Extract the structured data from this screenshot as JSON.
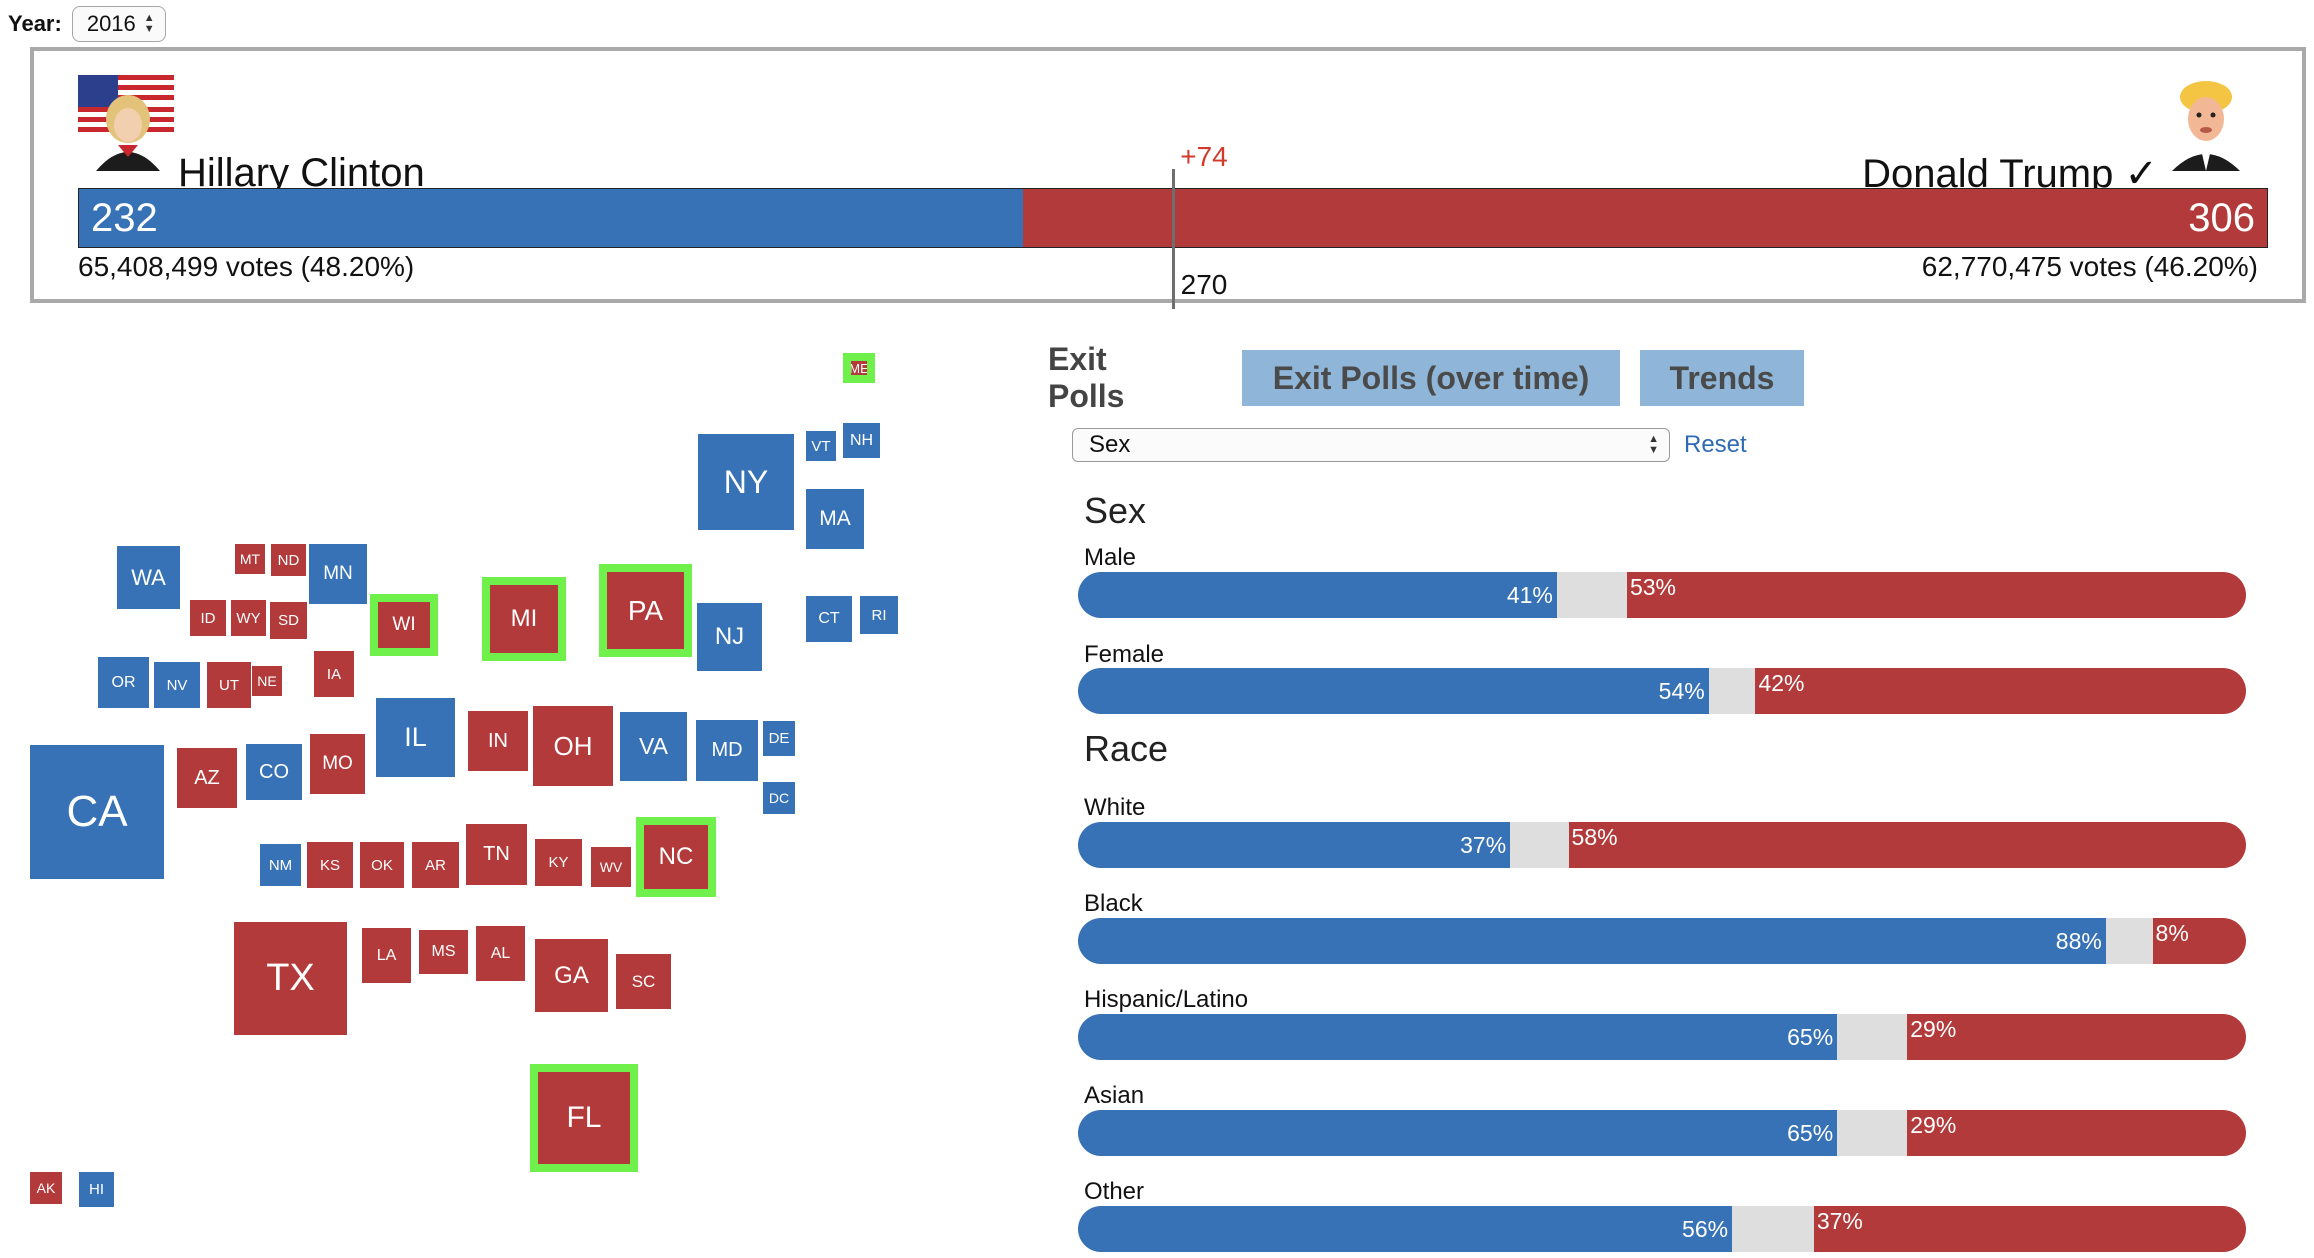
{
  "year": {
    "label": "Year:",
    "value": "2016"
  },
  "summary": {
    "left": {
      "name": "Hillary Clinton",
      "ev": "232",
      "votes": "65,408,499 votes (48.20%)",
      "ev_value": 232,
      "color": "#3672b5"
    },
    "right": {
      "name": "Donald Trump ✓",
      "ev": "306",
      "votes": "62,770,475 votes (46.20%)",
      "ev_value": 306,
      "color": "#b23a3a"
    },
    "margin": "+74",
    "threshold": "270"
  },
  "colors": {
    "dem": "#3672b5",
    "rep": "#b23a3a",
    "highlight": "#6ff04a",
    "undecided": "#dedede"
  },
  "states": [
    {
      "code": "ME",
      "party": "rep",
      "hl": true
    },
    {
      "code": "VT",
      "party": "dem"
    },
    {
      "code": "NH",
      "party": "dem"
    },
    {
      "code": "NY",
      "party": "dem"
    },
    {
      "code": "MA",
      "party": "dem"
    },
    {
      "code": "WA",
      "party": "dem"
    },
    {
      "code": "MT",
      "party": "rep"
    },
    {
      "code": "ND",
      "party": "rep"
    },
    {
      "code": "MN",
      "party": "dem"
    },
    {
      "code": "ID",
      "party": "rep"
    },
    {
      "code": "WY",
      "party": "rep"
    },
    {
      "code": "SD",
      "party": "rep"
    },
    {
      "code": "WI",
      "party": "rep",
      "hl": true
    },
    {
      "code": "MI",
      "party": "rep",
      "hl": true
    },
    {
      "code": "PA",
      "party": "rep",
      "hl": true
    },
    {
      "code": "NJ",
      "party": "dem"
    },
    {
      "code": "CT",
      "party": "dem"
    },
    {
      "code": "RI",
      "party": "dem"
    },
    {
      "code": "OR",
      "party": "dem"
    },
    {
      "code": "NV",
      "party": "dem"
    },
    {
      "code": "UT",
      "party": "rep"
    },
    {
      "code": "NE",
      "party": "rep"
    },
    {
      "code": "IA",
      "party": "rep"
    },
    {
      "code": "IL",
      "party": "dem"
    },
    {
      "code": "IN",
      "party": "rep"
    },
    {
      "code": "OH",
      "party": "rep"
    },
    {
      "code": "VA",
      "party": "dem"
    },
    {
      "code": "MD",
      "party": "dem"
    },
    {
      "code": "DE",
      "party": "dem"
    },
    {
      "code": "DC",
      "party": "dem"
    },
    {
      "code": "CA",
      "party": "dem"
    },
    {
      "code": "AZ",
      "party": "rep"
    },
    {
      "code": "CO",
      "party": "dem"
    },
    {
      "code": "MO",
      "party": "rep"
    },
    {
      "code": "NM",
      "party": "dem"
    },
    {
      "code": "KS",
      "party": "rep"
    },
    {
      "code": "OK",
      "party": "rep"
    },
    {
      "code": "AR",
      "party": "rep"
    },
    {
      "code": "TN",
      "party": "rep"
    },
    {
      "code": "KY",
      "party": "rep"
    },
    {
      "code": "WV",
      "party": "rep"
    },
    {
      "code": "NC",
      "party": "rep",
      "hl": true
    },
    {
      "code": "TX",
      "party": "rep"
    },
    {
      "code": "LA",
      "party": "rep"
    },
    {
      "code": "MS",
      "party": "rep"
    },
    {
      "code": "AL",
      "party": "rep"
    },
    {
      "code": "GA",
      "party": "rep"
    },
    {
      "code": "SC",
      "party": "rep"
    },
    {
      "code": "FL",
      "party": "rep",
      "hl": true
    },
    {
      "code": "AK",
      "party": "rep"
    },
    {
      "code": "HI",
      "party": "dem"
    }
  ],
  "tabs": [
    {
      "label": "Exit Polls",
      "active": true
    },
    {
      "label": "Exit Polls (over time)",
      "active": false
    },
    {
      "label": "Trends",
      "active": false
    }
  ],
  "filter": {
    "selected": "Sex",
    "reset": "Reset"
  },
  "exit_polls": [
    {
      "group": "Sex",
      "rows": [
        {
          "label": "Male",
          "dem": 41,
          "rep": 53,
          "dem_text": "41%",
          "rep_text": "53%"
        },
        {
          "label": "Female",
          "dem": 54,
          "rep": 42,
          "dem_text": "54%",
          "rep_text": "42%"
        }
      ]
    },
    {
      "group": "Race",
      "rows": [
        {
          "label": "White",
          "dem": 37,
          "rep": 58,
          "dem_text": "37%",
          "rep_text": "58%"
        },
        {
          "label": "Black",
          "dem": 88,
          "rep": 8,
          "dem_text": "88%",
          "rep_text": "8%"
        },
        {
          "label": "Hispanic/Latino",
          "dem": 65,
          "rep": 29,
          "dem_text": "65%",
          "rep_text": "29%"
        },
        {
          "label": "Asian",
          "dem": 65,
          "rep": 29,
          "dem_text": "65%",
          "rep_text": "29%"
        },
        {
          "label": "Other",
          "dem": 56,
          "rep": 37,
          "dem_text": "56%",
          "rep_text": "37%"
        }
      ]
    }
  ]
}
